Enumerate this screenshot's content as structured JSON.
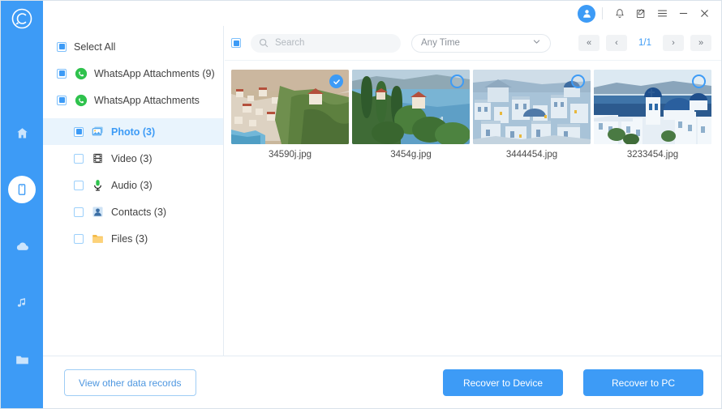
{
  "brand": {
    "logo_icon": "app-logo-circle-c",
    "accent_color": "#3d9bf6",
    "rail_color": "#3d9bf6"
  },
  "titlebar": {
    "avatar_icon": "user-avatar-icon",
    "buttons": [
      {
        "name": "notification-bell-icon",
        "glyph": "bell"
      },
      {
        "name": "feedback-note-icon",
        "glyph": "note"
      },
      {
        "name": "menu-hamburger-icon",
        "glyph": "menu"
      },
      {
        "name": "minimize-icon",
        "glyph": "minimize"
      },
      {
        "name": "close-icon",
        "glyph": "close"
      }
    ]
  },
  "rail": {
    "items": [
      {
        "name": "home",
        "icon": "home-icon",
        "active": false
      },
      {
        "name": "device",
        "icon": "phone-device-icon",
        "active": true
      },
      {
        "name": "cloud",
        "icon": "cloud-icon",
        "active": false
      },
      {
        "name": "music",
        "icon": "music-note-icon",
        "active": false
      },
      {
        "name": "files",
        "icon": "folder-icon",
        "active": false
      }
    ]
  },
  "sidebar": {
    "select_all": {
      "label": "Select All",
      "state": "partial"
    },
    "groups": [
      {
        "label": "WhatsApp Attachments (9)",
        "icon": "whatsapp-icon",
        "state": "partial"
      },
      {
        "label": "WhatsApp Attachments",
        "icon": "whatsapp-icon",
        "state": "partial"
      }
    ],
    "children": [
      {
        "label": "Photo (3)",
        "icon": "photo-icon",
        "state": "partial",
        "active": true
      },
      {
        "label": "Video (3)",
        "icon": "video-icon",
        "state": "empty",
        "active": false
      },
      {
        "label": "Audio (3)",
        "icon": "audio-mic-icon",
        "state": "empty",
        "active": false
      },
      {
        "label": "Contacts (3)",
        "icon": "contacts-icon",
        "state": "empty",
        "active": false
      },
      {
        "label": "Files (3)",
        "icon": "files-folder-icon",
        "state": "empty",
        "active": false
      }
    ]
  },
  "toolbar": {
    "select_all_state": "partial",
    "search": {
      "value": "",
      "placeholder": "Search",
      "icon": "search-icon"
    },
    "time_filter": {
      "value": "Any Time",
      "icon": "chevron-down-icon"
    },
    "pagination": {
      "first_label": "«",
      "prev_label": "‹",
      "page_text": "1/1",
      "next_label": "›",
      "last_label": "»"
    }
  },
  "gallery": {
    "items": [
      {
        "filename": "34590j.jpg",
        "selected": true,
        "scene": "coast-town"
      },
      {
        "filename": "3454g.jpg",
        "selected": false,
        "scene": "lake-cypress"
      },
      {
        "filename": "3444454.jpg",
        "selected": false,
        "scene": "blue-village"
      },
      {
        "filename": "3233454.jpg",
        "selected": false,
        "scene": "santorini-domes"
      }
    ]
  },
  "footer": {
    "view_other": "View other data records",
    "recover_device": "Recover to Device",
    "recover_pc": "Recover to PC"
  }
}
